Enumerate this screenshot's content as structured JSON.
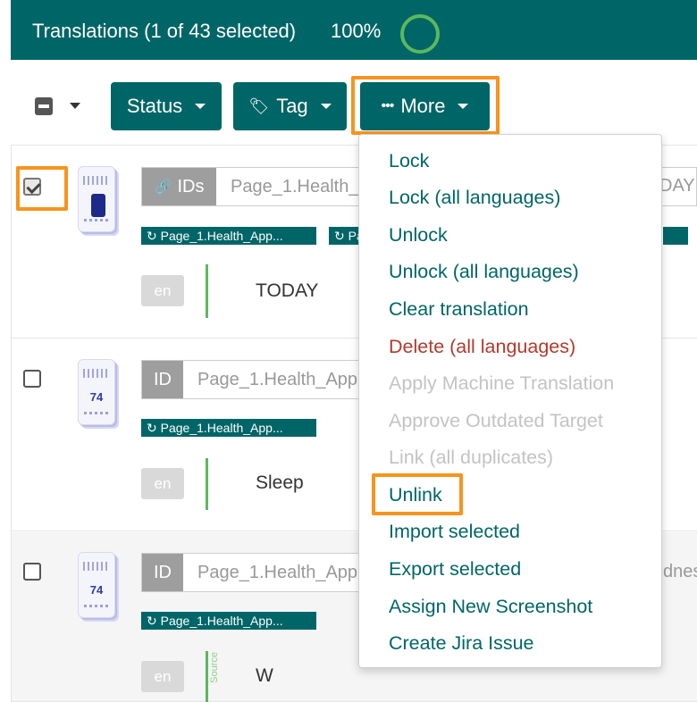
{
  "header": {
    "title": "Translations (1 of 43 selected)",
    "percent": "100%",
    "progress": 100
  },
  "toolbar": {
    "status_label": "Status",
    "tag_label": "Tag",
    "more_label": "More",
    "more_icon": "•••",
    "tag_icon": "🏷"
  },
  "rows": [
    {
      "id_label": "IDs",
      "id_value": "Page_1.Health_",
      "id_overflow": "DAY",
      "tag1": "Page_1.Health_App...",
      "tag2": "Pa",
      "lang": "en",
      "text": "TODAY",
      "checked": true
    },
    {
      "id_label": "ID",
      "id_value": "Page_1.Health_App",
      "tag1": "Page_1.Health_App...",
      "lang": "en",
      "text": "Sleep",
      "thumb_number": "74",
      "checked": false
    },
    {
      "id_label": "ID",
      "id_value": "Page_1.Health_App",
      "id_overflow": "dnes",
      "tag1": "Page_1.Health_App...",
      "lang": "en",
      "text": "W",
      "source_label": "Source",
      "thumb_number": "74",
      "checked": false
    }
  ],
  "menu": {
    "lock": "Lock",
    "lock_all": "Lock (all languages)",
    "unlock": "Unlock",
    "unlock_all": "Unlock (all languages)",
    "clear": "Clear translation",
    "delete_all": "Delete (all languages)",
    "apply_mt": "Apply Machine Translation",
    "approve_outdated": "Approve Outdated Target",
    "link_all": "Link (all duplicates)",
    "unlink": "Unlink",
    "import_selected": "Import selected",
    "export_selected": "Export selected",
    "assign_screenshot": "Assign New Screenshot",
    "create_jira": "Create Jira Issue"
  },
  "colors": {
    "brand": "#006567",
    "highlight": "#f7941d",
    "danger": "#b03a2e",
    "progress_ring": "#5cb85c"
  }
}
